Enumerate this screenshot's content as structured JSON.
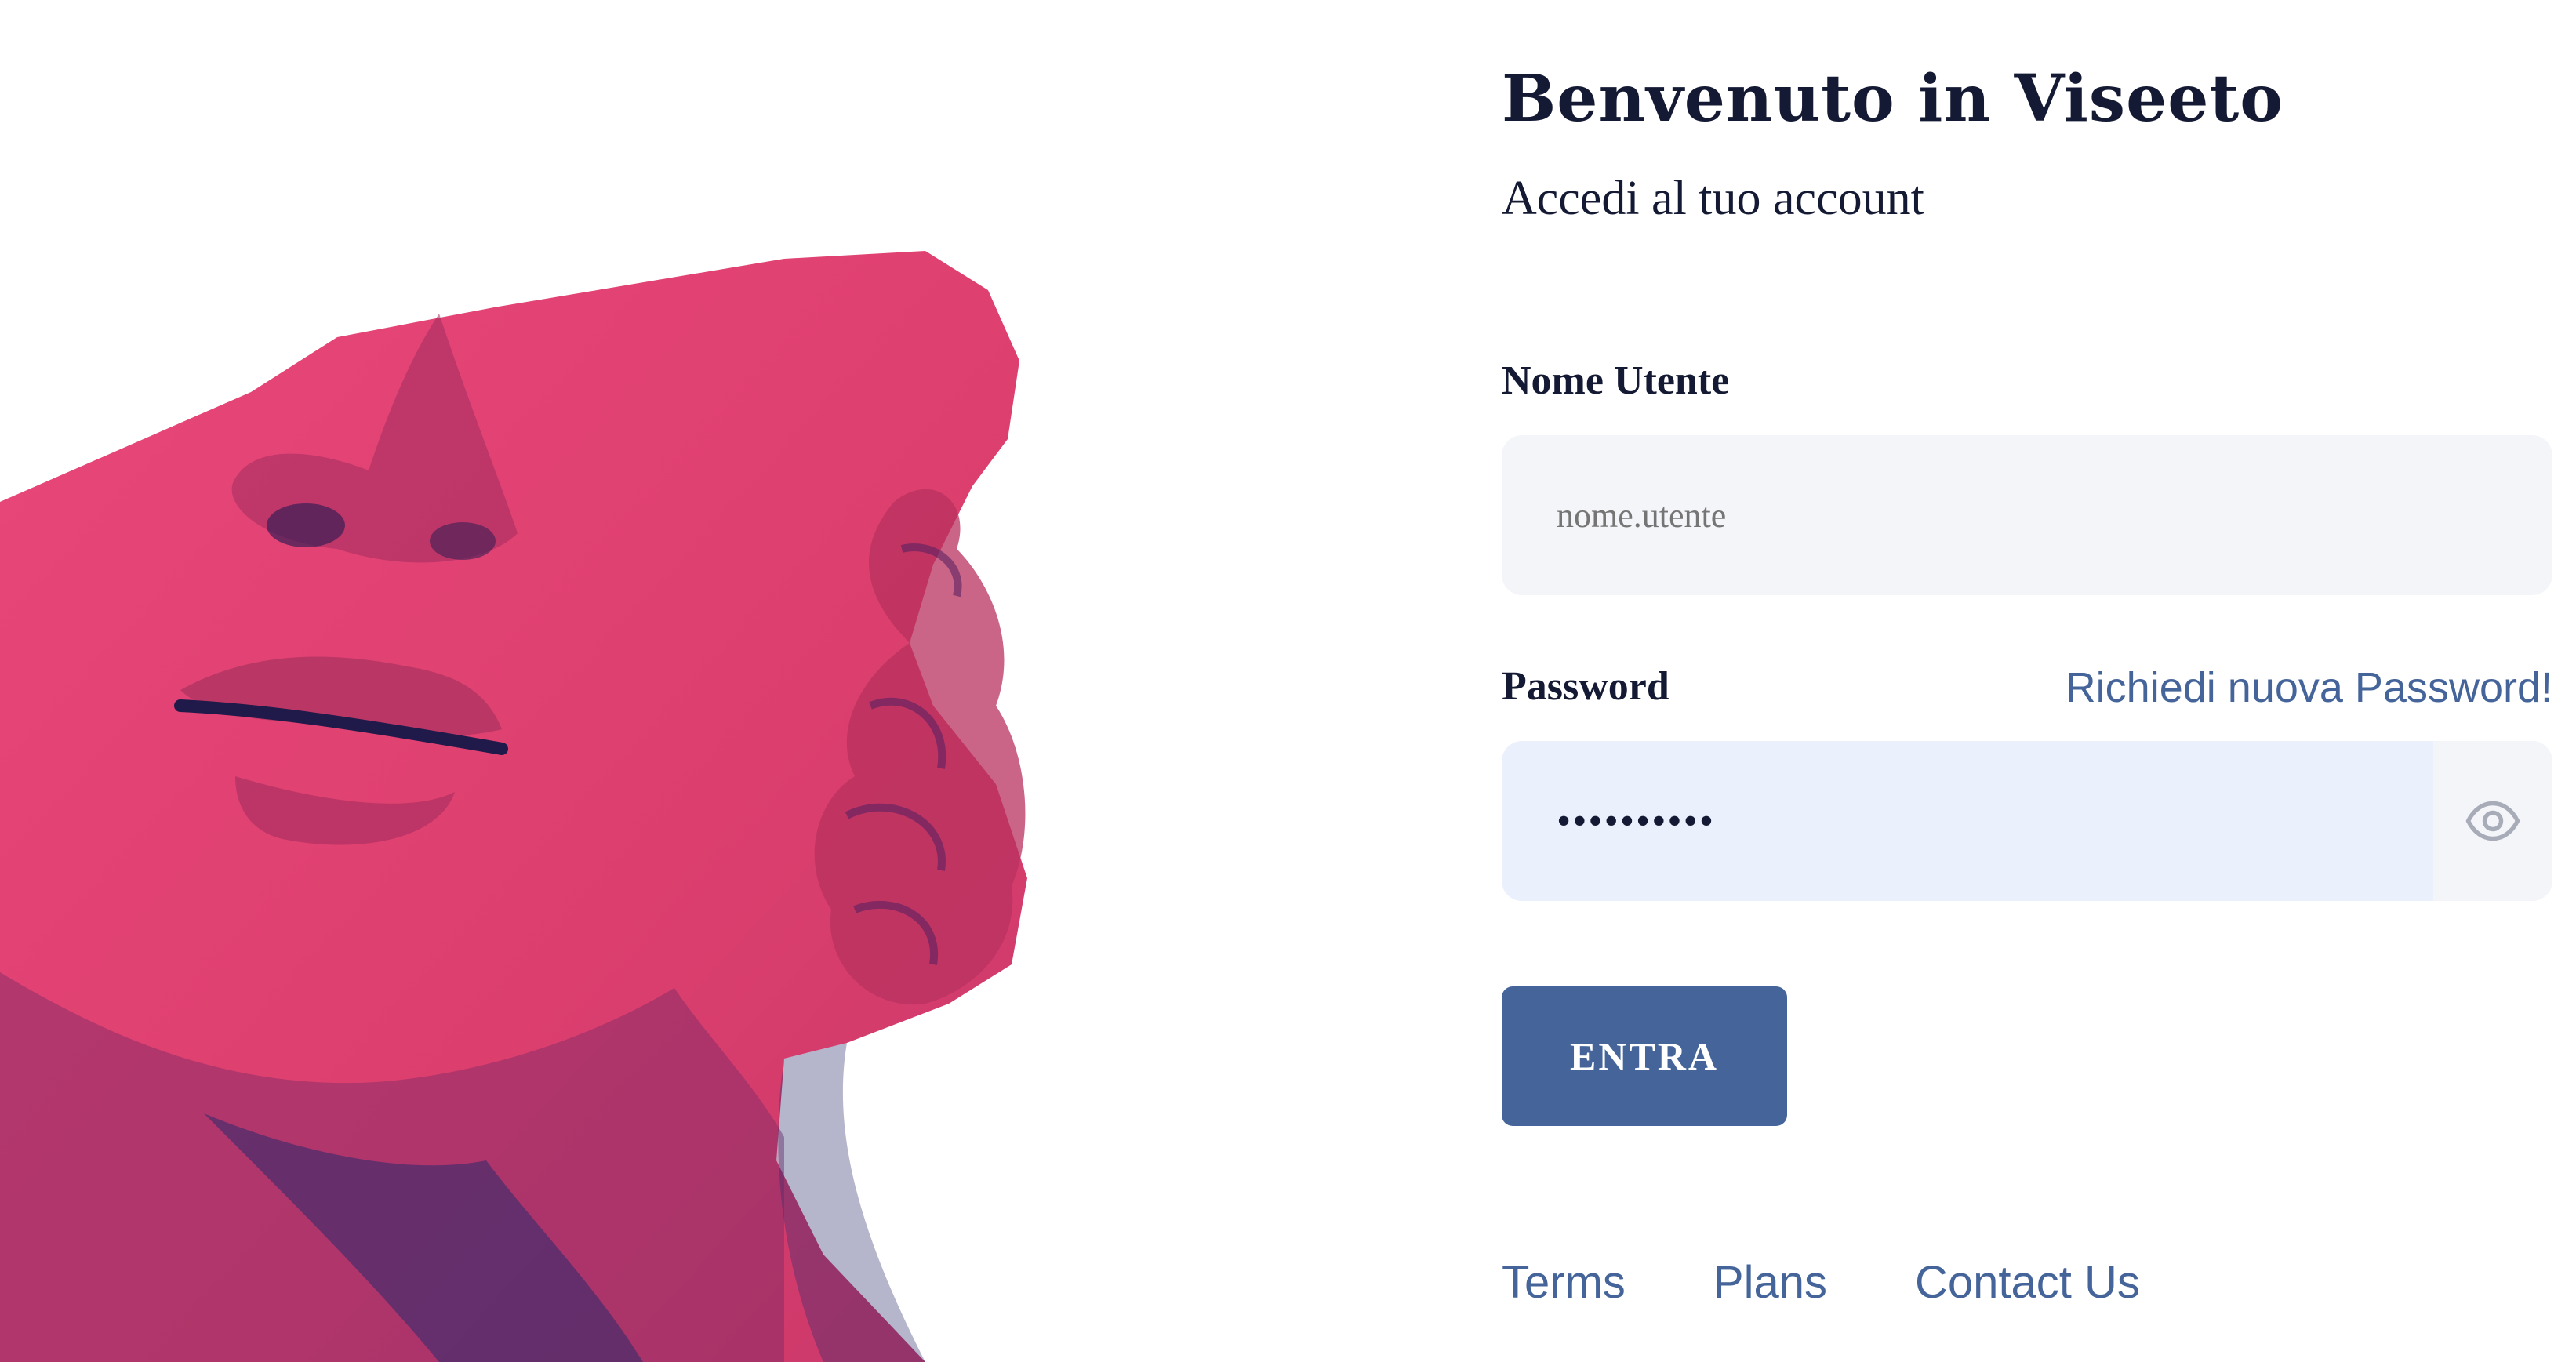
{
  "login": {
    "title": "Benvenuto in Viseeto",
    "subtitle": "Accedi al tuo account",
    "username": {
      "label": "Nome Utente",
      "value": "",
      "placeholder": "nome.utente"
    },
    "password": {
      "label": "Password",
      "value": "••••••••••",
      "forgot_link": "Richiedi nuova Password!",
      "toggle_icon": "eye-icon"
    },
    "submit_label": "ENTRA"
  },
  "footer": {
    "terms": "Terms",
    "plans": "Plans",
    "contact": "Contact Us"
  },
  "illustration": {
    "subject": "statue-head",
    "tint_color": "#e0446f",
    "shadow_color": "#2a2a6e"
  },
  "colors": {
    "heading": "#141a33",
    "accent": "#45659a",
    "input_bg": "#f4f5f9",
    "input_active_bg": "#eaf0fc",
    "background": "#ffffff"
  }
}
